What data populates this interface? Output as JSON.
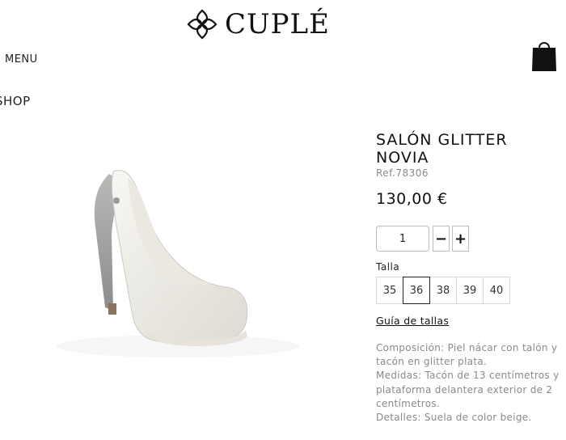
{
  "brand": {
    "name": "CUPLÉ"
  },
  "nav": {
    "menu_label": "MENU",
    "section_label": "SHOP"
  },
  "product": {
    "title": "SALÓN GLITTER NOVIA",
    "ref": "Ref.78306",
    "price": "130,00 €",
    "quantity": "1",
    "minus_label": "−",
    "plus_label": "+",
    "size_label": "Talla",
    "sizes": [
      "35",
      "36",
      "38",
      "39",
      "40"
    ],
    "selected_size": "36",
    "size_guide": "Guía de tallas",
    "description": [
      "Composición: Piel nácar con talón y tacón en glitter plata.",
      "Medidas: Tacón de 13 centímetros y plataforma delantera exterior de 2 centímetros.",
      "Detalles: Suela de color beige."
    ]
  },
  "icons": {
    "logo": "cuple-knot-logo",
    "cart": "shopping-bag-icon",
    "image": "white-high-heel-shoe"
  }
}
